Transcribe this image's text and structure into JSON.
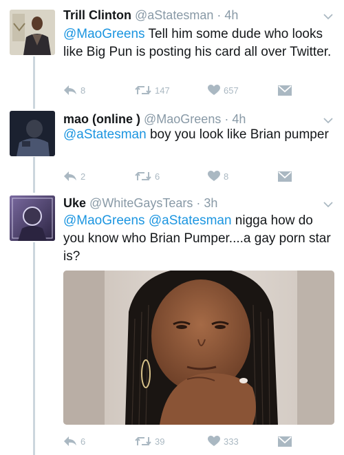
{
  "tweets": [
    {
      "name": "Trill Clinton",
      "handle": "@aStatesman",
      "time": "· 4h",
      "mention": "@MaoGreens",
      "text": " Tell him some dude who looks like Big Pun is posting his card all over Twitter.",
      "replies": "8",
      "retweets": "147",
      "likes": "657"
    },
    {
      "name": "mao (online )",
      "handle": "@MaoGreens",
      "time": "· 4h",
      "mention": "@aStatesman",
      "text": " boy you look like Brian pumper",
      "replies": "2",
      "retweets": "6",
      "likes": "8"
    },
    {
      "name": "Uke",
      "handle": "@WhiteGaysTears",
      "time": "· 3h",
      "mention": "@MaoGreens",
      "mention2": "@aStatesman",
      "text": " nigga how do you know who Brian Pumper....a gay porn star is?",
      "replies": "6",
      "retweets": "39",
      "likes": "333"
    }
  ],
  "icons": {
    "reply": "reply-icon",
    "retweet": "retweet-icon",
    "like": "heart-icon",
    "dm": "envelope-icon",
    "menu": "chevron-down-icon"
  },
  "colors": {
    "link": "#1b95e0",
    "meta": "#8899a6",
    "action": "#aab8c2",
    "thread_line": "#ccd6dd"
  }
}
